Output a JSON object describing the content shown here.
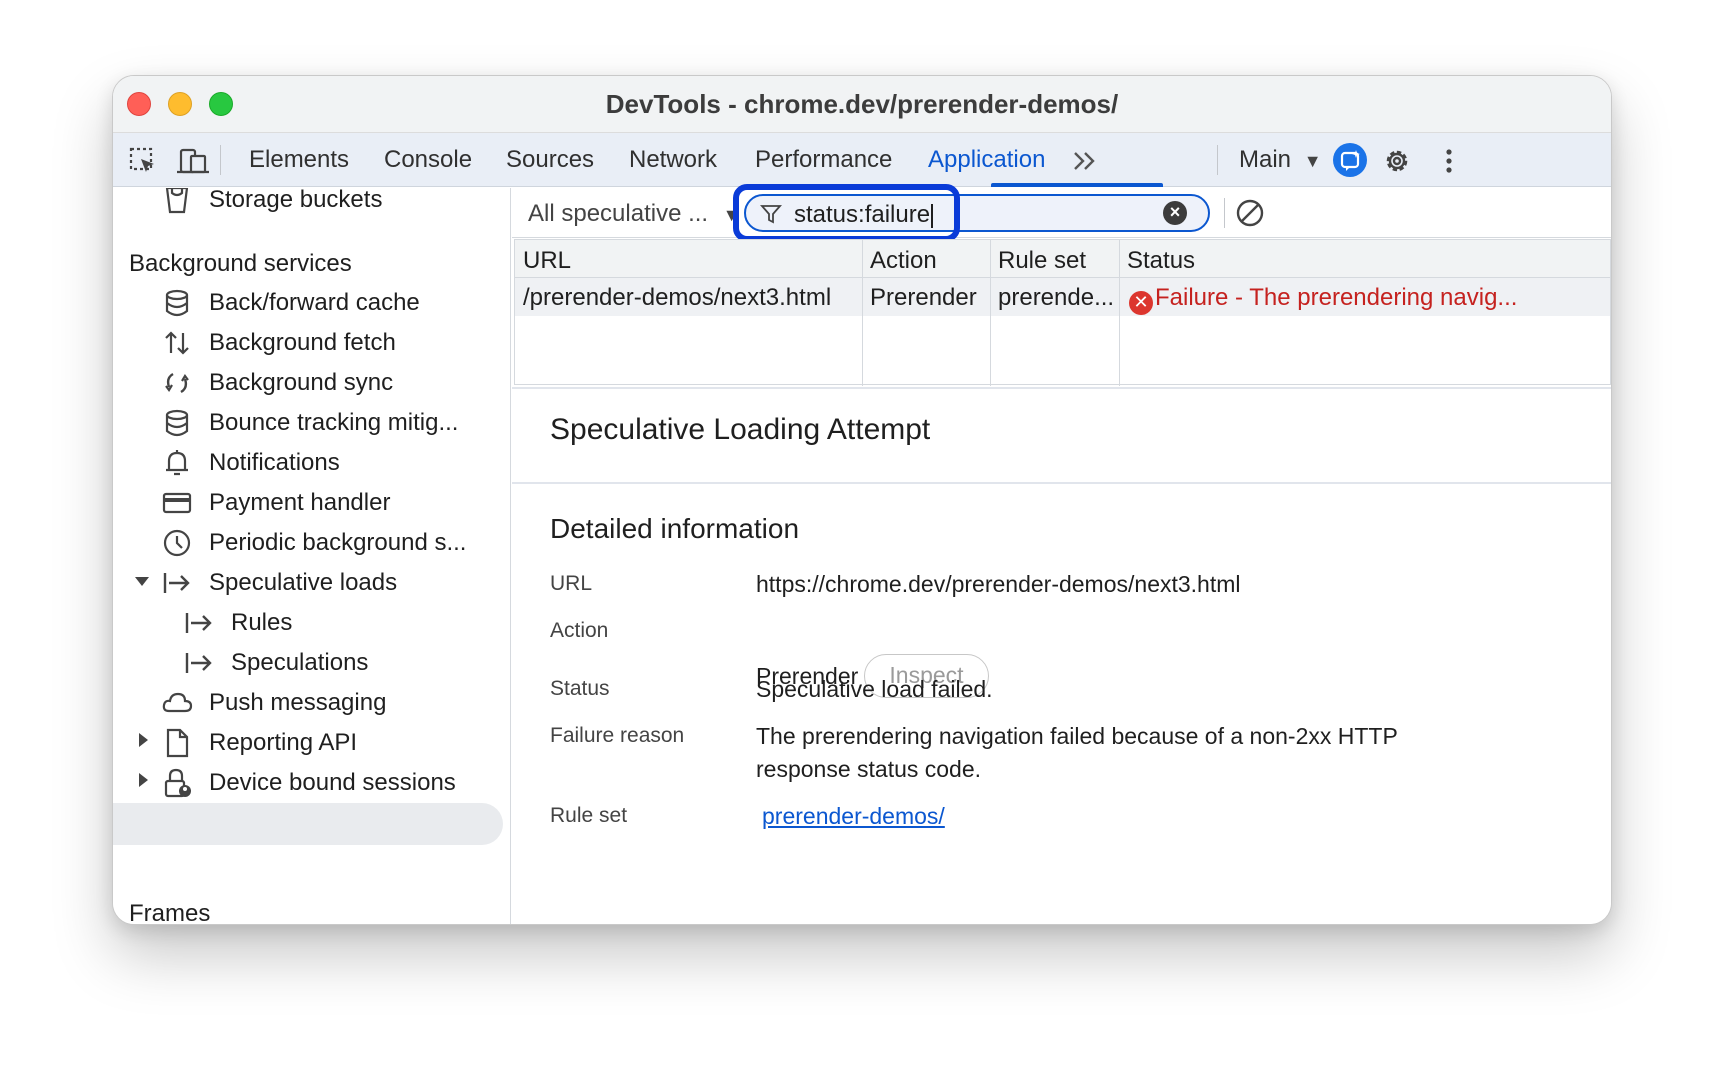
{
  "window": {
    "title": "DevTools - chrome.dev/prerender-demos/"
  },
  "tabs": [
    "Elements",
    "Console",
    "Sources",
    "Network",
    "Performance",
    "Application"
  ],
  "active_tab": "Application",
  "toolbar_right": {
    "context_label": "Main"
  },
  "sidebar": {
    "top_item": "Storage buckets",
    "background_services_heading": "Background services",
    "items": [
      {
        "label": "Back/forward cache",
        "icon": "database-icon"
      },
      {
        "label": "Background fetch",
        "icon": "up-down-arrows-icon"
      },
      {
        "label": "Background sync",
        "icon": "sync-icon"
      },
      {
        "label": "Bounce tracking mitig...",
        "icon": "database-icon"
      },
      {
        "label": "Notifications",
        "icon": "bell-icon"
      },
      {
        "label": "Payment handler",
        "icon": "card-icon"
      },
      {
        "label": "Periodic background s...",
        "icon": "clock-icon"
      },
      {
        "label": "Speculative loads",
        "icon": "arrow-right-bar-icon"
      },
      {
        "label": "Rules",
        "icon": "arrow-right-bar-icon"
      },
      {
        "label": "Speculations",
        "icon": "arrow-right-bar-icon"
      },
      {
        "label": "Push messaging",
        "icon": "cloud-icon"
      },
      {
        "label": "Reporting API",
        "icon": "document-icon"
      },
      {
        "label": "Device bound sessions",
        "icon": "lock-icon"
      }
    ],
    "frames_heading": "Frames",
    "selected": "Speculations"
  },
  "filter_bar": {
    "dropdown_label": "All speculative ...",
    "filter_value": "status:failure"
  },
  "table": {
    "columns": [
      "URL",
      "Action",
      "Rule set",
      "Status"
    ],
    "rows": [
      {
        "url": "/prerender-demos/next3.html",
        "action": "Prerender",
        "rule_set": "prerende...",
        "status": "Failure - The prerendering navig..."
      }
    ]
  },
  "detail": {
    "title": "Speculative Loading Attempt",
    "section_title": "Detailed information",
    "labels": {
      "url": "URL",
      "action": "Action",
      "status": "Status",
      "failure_reason": "Failure reason",
      "rule_set": "Rule set"
    },
    "url_value": "https://chrome.dev/prerender-demos/next3.html",
    "action_value": "Prerender",
    "inspect_label": "Inspect",
    "status_value": "Speculative load failed.",
    "failure_reason_line1": "The prerendering navigation failed because of a non-2xx HTTP",
    "failure_reason_line2": "response status code.",
    "rule_set_value": "prerender-demos/"
  },
  "colors": {
    "accent": "#0b57d0",
    "failure": "#c5221f",
    "highlight": "#0a3bd8"
  }
}
